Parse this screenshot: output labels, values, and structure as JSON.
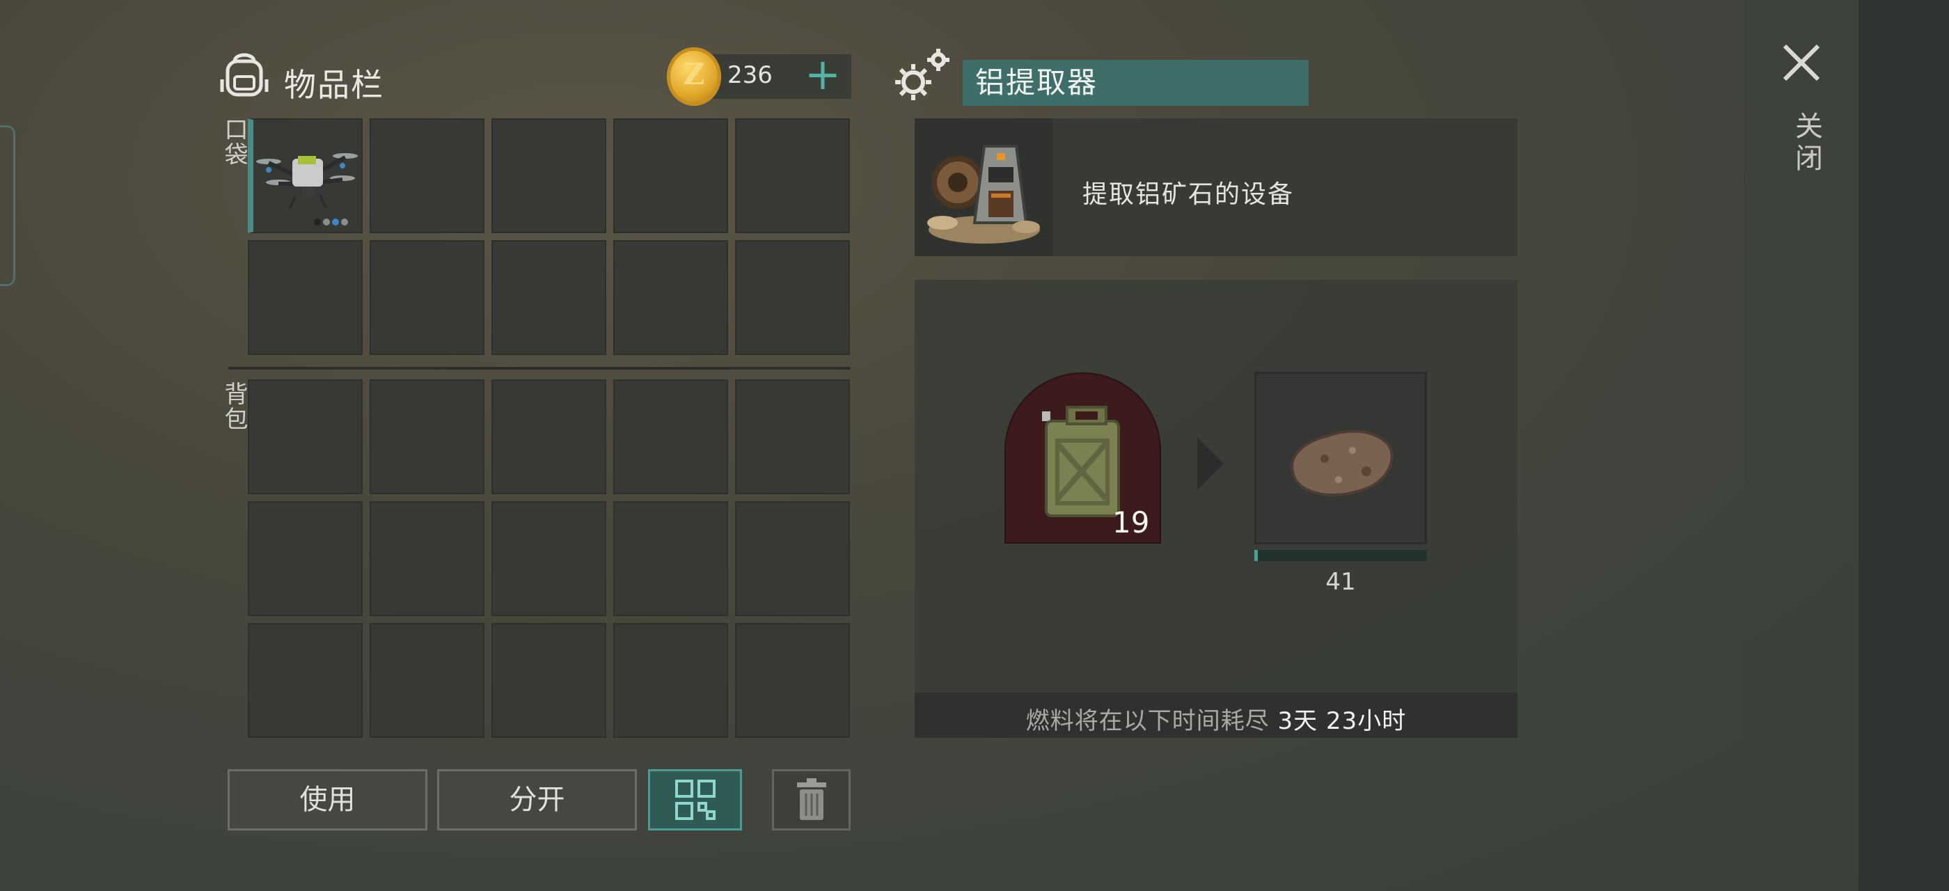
{
  "inventory": {
    "title": "物品栏",
    "coins": "236",
    "pocket_label": "口袋",
    "backpack_label": "背包"
  },
  "actions": {
    "use": "使用",
    "split": "分开"
  },
  "crafter": {
    "title": "铝提取器",
    "description": "提取铝矿石的设备",
    "fuel_count": "19",
    "output_count": "41",
    "output_progress": 0.02,
    "fuel_prefix": "燃料将在以下时间耗尽",
    "fuel_time": "3天 23小时"
  },
  "close_label": "关闭",
  "colors": {
    "accent_teal": "#4b9c94",
    "fuel_slot": "#3d1a1c"
  },
  "icons": [
    "backpack-icon",
    "coin-icon",
    "plus-icon",
    "gear-icon",
    "drone-icon",
    "extractor-icon",
    "jerrycan-icon",
    "ore-icon",
    "sort-icon",
    "trash-icon",
    "close-icon"
  ]
}
